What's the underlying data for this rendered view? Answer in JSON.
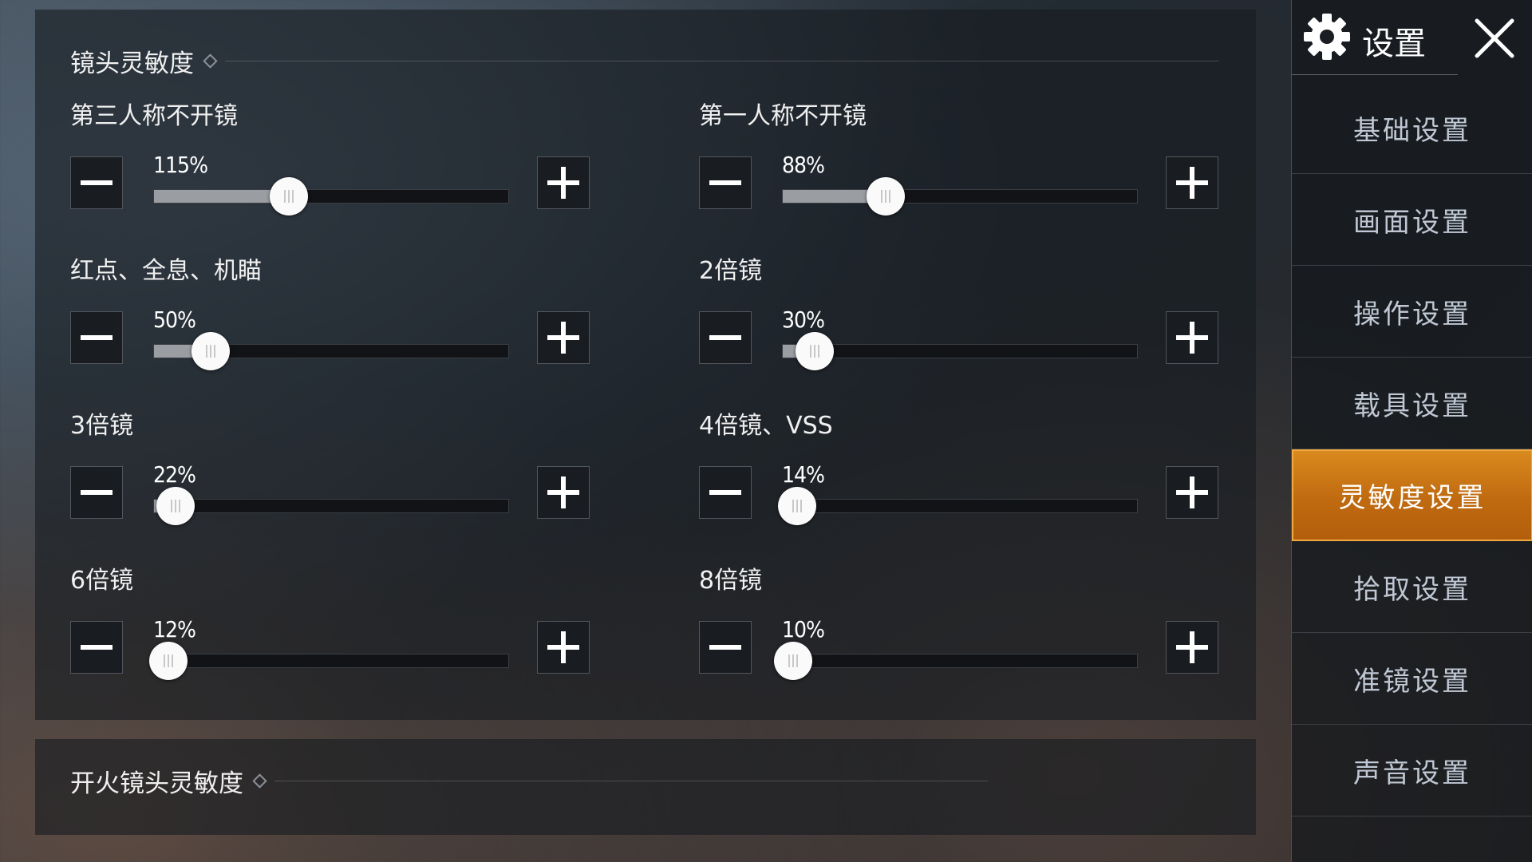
{
  "lens_section": {
    "title": "镜头灵敏度",
    "settings": [
      {
        "label": "第三人称不开镜",
        "value_text": "115%",
        "fill_fraction": 0.38
      },
      {
        "label": "第一人称不开镜",
        "value_text": "88%",
        "fill_fraction": 0.29
      },
      {
        "label": "红点、全息、机瞄",
        "value_text": "50%",
        "fill_fraction": 0.16
      },
      {
        "label": "2倍镜",
        "value_text": "30%",
        "fill_fraction": 0.09
      },
      {
        "label": "3倍镜",
        "value_text": "22%",
        "fill_fraction": 0.06
      },
      {
        "label": "4倍镜、VSS",
        "value_text": "14%",
        "fill_fraction": 0.04
      },
      {
        "label": "6倍镜",
        "value_text": "12%",
        "fill_fraction": 0.04
      },
      {
        "label": "8倍镜",
        "value_text": "10%",
        "fill_fraction": 0.03
      }
    ]
  },
  "fire_section": {
    "title": "开火镜头灵敏度"
  },
  "sidebar": {
    "title": "设置",
    "gear_icon": "gear-icon",
    "close_icon": "close-icon",
    "items": [
      {
        "label": "基础设置",
        "active": false
      },
      {
        "label": "画面设置",
        "active": false
      },
      {
        "label": "操作设置",
        "active": false
      },
      {
        "label": "载具设置",
        "active": false
      },
      {
        "label": "灵敏度设置",
        "active": true
      },
      {
        "label": "拾取设置",
        "active": false
      },
      {
        "label": "准镜设置",
        "active": false
      },
      {
        "label": "声音设置",
        "active": false
      }
    ]
  },
  "colors": {
    "accent": "#d98a1e",
    "track_fill": "#9a9da1",
    "panel_bg": "#161b21"
  }
}
